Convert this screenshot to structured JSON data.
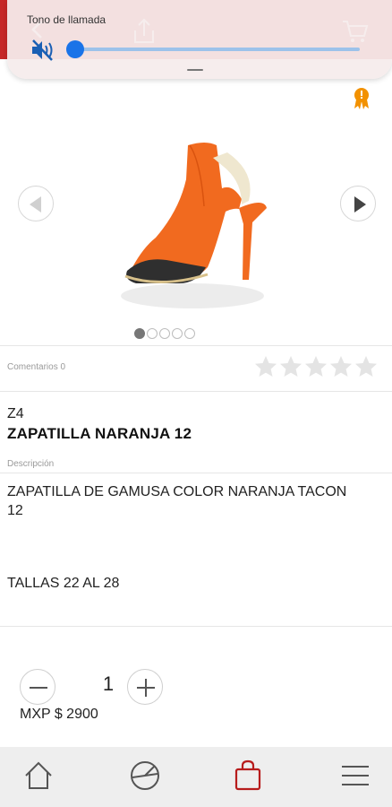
{
  "volume_overlay": {
    "label": "Tono de llamada",
    "level": 0.03,
    "icons": [
      "mute-icon"
    ]
  },
  "toolbar": {
    "icons": [
      "back-arrow-icon",
      "share-icon",
      "cart-icon"
    ],
    "color": "#c62828"
  },
  "badge": {
    "icon": "award-icon",
    "color": "#f29100"
  },
  "gallery": {
    "image": "orange-suede-heel",
    "prev_icon": "chevron-left-icon",
    "next_icon": "chevron-right-icon",
    "page_count": 5,
    "current_page": 1
  },
  "rating": {
    "comments_label": "Comentarios 0",
    "stars_filled": 0,
    "stars_total": 5
  },
  "product": {
    "code": "Z4",
    "title": "ZAPATILLA NARANJA 12",
    "description_label": "Descripción",
    "description_line1": "ZAPATILLA DE GAMUSA COLOR NARANJA TACON",
    "description_line2": "12",
    "sizes": "TALLAS 22 AL 28"
  },
  "purchase": {
    "quantity": "1",
    "price": "MXP $ 2900"
  },
  "bottom_nav": {
    "items": [
      "home-icon",
      "catalog-icon",
      "shopping-bag-icon",
      "menu-icon"
    ],
    "active": "shopping-bag-icon",
    "active_color": "#b71c1c"
  }
}
